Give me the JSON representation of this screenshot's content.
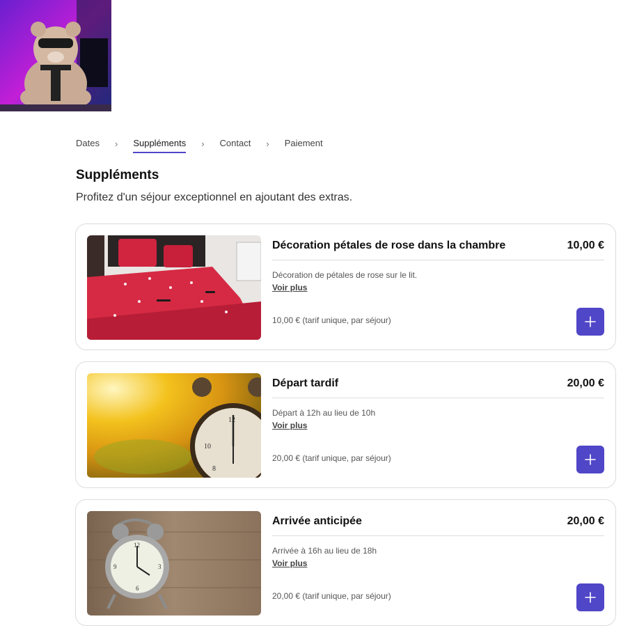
{
  "breadcrumb": {
    "steps": [
      "Dates",
      "Suppléments",
      "Contact",
      "Paiement"
    ],
    "active": "Suppléments",
    "separator": "›"
  },
  "page": {
    "title": "Suppléments",
    "subtitle": "Profitez d'un séjour exceptionnel en ajoutant des extras."
  },
  "extras": [
    {
      "name": "Décoration pétales de rose dans la chambre",
      "price": "10,00 €",
      "description": "Décoration de pétales de rose sur le lit.",
      "more_label": "Voir plus",
      "tariff": "10,00 € (tarif unique, par séjour)"
    },
    {
      "name": "Départ tardif",
      "price": "20,00 €",
      "description": "Départ à 12h au lieu de 10h",
      "more_label": "Voir plus",
      "tariff": "20,00 € (tarif unique, par séjour)"
    },
    {
      "name": "Arrivée anticipée",
      "price": "20,00 €",
      "description": "Arrivée à 16h au lieu de 18h",
      "more_label": "Voir plus",
      "tariff": "20,00 € (tarif unique, par séjour)"
    }
  ],
  "colors": {
    "accent": "#5046c8",
    "border": "#dcdcdc"
  },
  "icons": {
    "add": "plus-icon",
    "separator": "chevron-right-icon"
  }
}
